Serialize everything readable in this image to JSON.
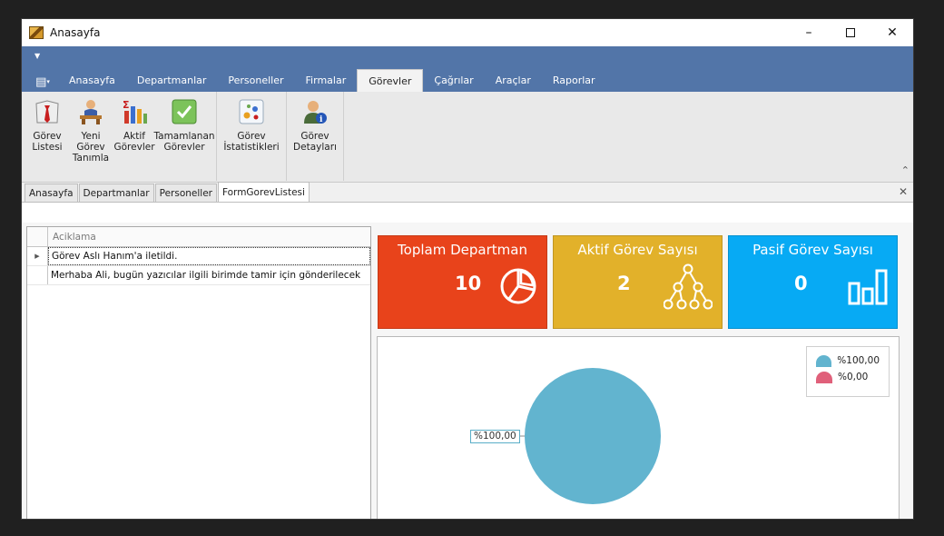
{
  "window": {
    "title": "Anasayfa"
  },
  "ribbon": {
    "tabs": [
      "Anasayfa",
      "Departmanlar",
      "Personeller",
      "Firmalar",
      "Görevler",
      "Çağrılar",
      "Araçlar",
      "Raporlar"
    ],
    "active_tab": "Görevler",
    "group1": [
      {
        "line1": "Görev",
        "line2": "Listesi",
        "icon": "necktie-icon"
      },
      {
        "line1": "Yeni Görev",
        "line2": "Tanımla",
        "icon": "desk-worker-icon"
      },
      {
        "line1": "Aktif",
        "line2": "Görevler",
        "icon": "sigma-chart-icon"
      },
      {
        "line1": "Tamamlanan",
        "line2": "Görevler",
        "icon": "checkmark-icon"
      }
    ],
    "group2": [
      {
        "line1": "Görev",
        "line2": "İstatistikleri",
        "icon": "dots-stats-icon"
      }
    ],
    "group3": [
      {
        "line1": "Görev",
        "line2": "Detayları",
        "icon": "user-info-icon"
      }
    ]
  },
  "doc_tabs": [
    "Anasayfa",
    "Departmanlar",
    "Personeller",
    "FormGorevListesi"
  ],
  "grid": {
    "column": "Aciklama",
    "rows": [
      "Görev Aslı Hanım'a iletildi.",
      "Merhaba Ali, bugün yazıcılar ilgili birimde tamir için gönderilecek"
    ]
  },
  "tiles": [
    {
      "title": "Toplam Departman",
      "value": "10",
      "color": "#e8431b",
      "icon": "pie-chart-icon"
    },
    {
      "title": "Aktif Görev Sayısı",
      "value": "2",
      "color": "#e2b12a",
      "icon": "tree-hierarchy-icon"
    },
    {
      "title": "Pasif Görev Sayısı",
      "value": "0",
      "color": "#07aaf4",
      "icon": "bar-chart-icon"
    }
  ],
  "chart_data": {
    "type": "pie",
    "title": "",
    "slices": [
      {
        "label": "%100,00",
        "value": 100,
        "color": "#62b4cf"
      },
      {
        "label": "%0,00",
        "value": 0,
        "color": "#e0607a"
      }
    ],
    "point_label": "%100,00",
    "legend_position": "top-right"
  }
}
